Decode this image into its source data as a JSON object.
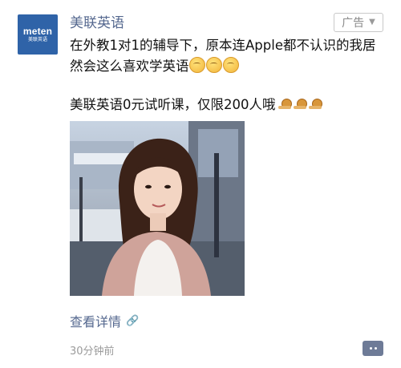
{
  "account": {
    "name": "美联英语",
    "logo_main": "meten",
    "logo_sub": "美联英语"
  },
  "ad_badge": {
    "label": "广告",
    "chevron": "chevron-down-icon"
  },
  "post": {
    "line1": "在外教1对1的辅导下，原本连Apple都不认识的我居然会这么喜欢学英语",
    "line2": "美联英语0元试听课，仅限200人哦",
    "emoji1_count": 3,
    "emoji2_count": 3
  },
  "footer": {
    "details_link": "查看详情",
    "details_icon": "link-icon",
    "time": "30分钟前",
    "comment_icon": "comment-icon"
  },
  "colors": {
    "account_name": "#55688f",
    "logo_bg": "#2f63a8",
    "timestamp": "#9b9b9b"
  }
}
